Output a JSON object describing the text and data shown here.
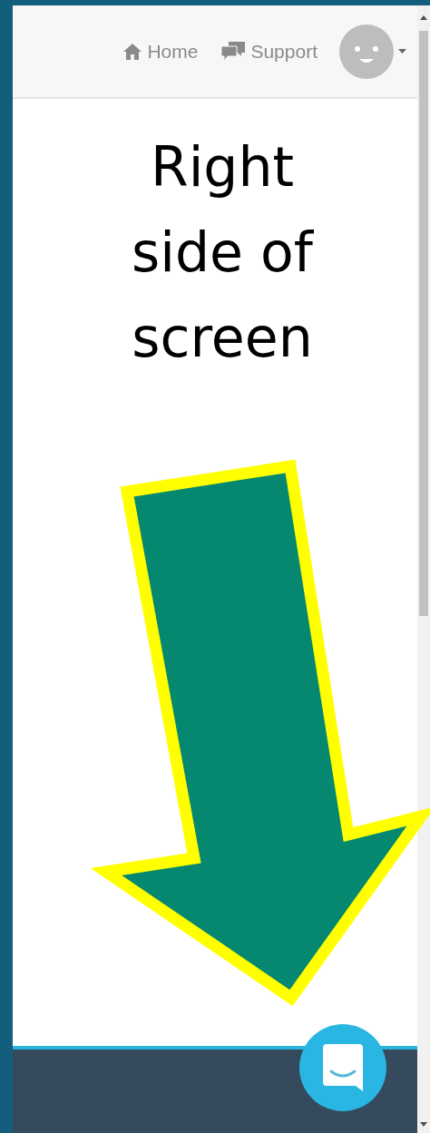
{
  "header": {
    "nav": [
      {
        "kind": "home",
        "label": "Home"
      },
      {
        "kind": "support",
        "label": "Support"
      }
    ],
    "avatar": {
      "menu": true
    }
  },
  "annotation": {
    "text": "Right side of screen"
  },
  "chat": {
    "kind": "messenger"
  }
}
